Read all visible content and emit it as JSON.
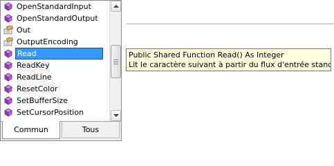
{
  "completion_list": {
    "items": [
      {
        "label": "OpenStandardInput",
        "icon": "method-icon"
      },
      {
        "label": "OpenStandardOutput",
        "icon": "method-icon"
      },
      {
        "label": "Out",
        "icon": "property-icon"
      },
      {
        "label": "OutputEncoding",
        "icon": "property-icon"
      },
      {
        "label": "Read",
        "icon": "method-icon",
        "selected": true
      },
      {
        "label": "ReadKey",
        "icon": "method-icon"
      },
      {
        "label": "ReadLine",
        "icon": "method-icon"
      },
      {
        "label": "ResetColor",
        "icon": "method-icon"
      },
      {
        "label": "SetBufferSize",
        "icon": "method-icon"
      },
      {
        "label": "SetCursorPosition",
        "icon": "method-icon"
      }
    ],
    "selected_index": 4
  },
  "tabs": {
    "commun": "Commun",
    "tous": "Tous",
    "active": "Commun"
  },
  "tooltip": {
    "signature": "Public Shared Function Read() As Integer",
    "description": "Lit le caractère suivant à partir du flux d'entrée standard."
  },
  "colors": {
    "selection": "#3399ff",
    "method_icon": "#a64fc8",
    "tooltip_background": "#ffffe1"
  }
}
